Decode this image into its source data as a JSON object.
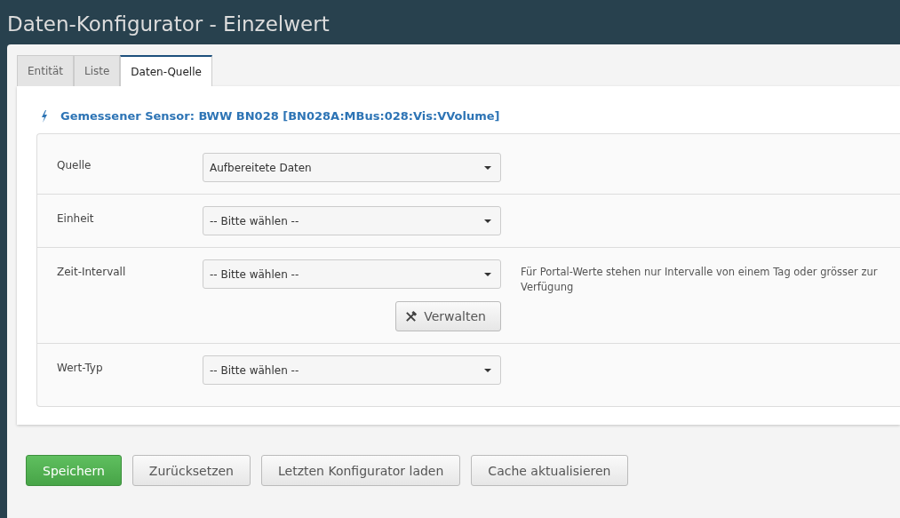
{
  "title": "Daten-Konfigurator - Einzelwert",
  "tabs": [
    {
      "label": "Entität",
      "selected": false
    },
    {
      "label": "Liste",
      "selected": false
    },
    {
      "label": "Daten-Quelle",
      "selected": true
    }
  ],
  "sensor_heading": "Gemessener Sensor: BWW BN028 [BN028A:MBus:028:Vis:VVolume]",
  "fields": [
    {
      "label": "Quelle",
      "value": "Aufbereitete Daten"
    },
    {
      "label": "Einheit",
      "value": "-- Bitte wählen --"
    },
    {
      "label": "Zeit-Intervall",
      "value": "-- Bitte wählen --",
      "help": "Für Portal-Werte stehen nur Intervalle von einem Tag oder grösser zur Verfügung",
      "button": "Verwalten"
    },
    {
      "label": "Wert-Typ",
      "value": "-- Bitte wählen --"
    }
  ],
  "actions": [
    {
      "label": "Speichern",
      "kind": "primary"
    },
    {
      "label": "Zurücksetzen",
      "kind": "default"
    },
    {
      "label": "Letzten Konfigurator laden",
      "kind": "default"
    },
    {
      "label": "Cache aktualisieren",
      "kind": "default"
    }
  ]
}
